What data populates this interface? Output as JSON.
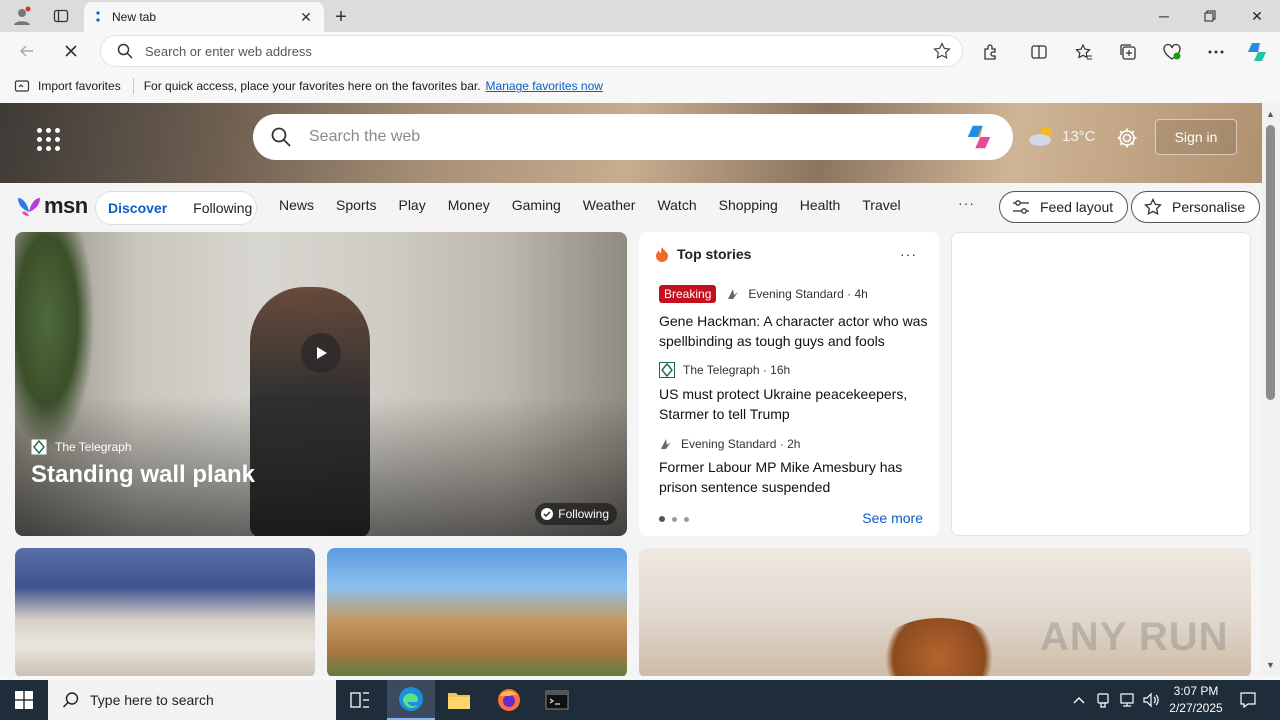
{
  "browser": {
    "tab_title": "New tab",
    "address_placeholder": "Search or enter web address"
  },
  "favorites_bar": {
    "import_label": "Import favorites",
    "hint": "For quick access, place your favorites here on the favorites bar.",
    "manage_link": "Manage favorites now"
  },
  "msn": {
    "search_placeholder": "Search the web",
    "temperature": "13°C",
    "sign_in": "Sign in",
    "logo_text": "msn",
    "feed_tabs": [
      "Discover",
      "Following"
    ],
    "categories": [
      "News",
      "Sports",
      "Play",
      "Money",
      "Gaming",
      "Weather",
      "Watch",
      "Shopping",
      "Health",
      "Travel"
    ],
    "more": "···",
    "feed_layout": "Feed layout",
    "personalise": "Personalise"
  },
  "hero": {
    "source": "The Telegraph",
    "title": "Standing wall plank",
    "following": "Following"
  },
  "top_stories": {
    "heading": "Top stories",
    "more": "···",
    "see_more": "See more",
    "stories": [
      {
        "badge": "Breaking",
        "source": "Evening Standard · 4h",
        "headline": "Gene Hackman: A character actor who was spellbinding as tough guys and fools"
      },
      {
        "badge": "",
        "source": "The Telegraph · 16h",
        "headline": "US must protect Ukraine peacekeepers, Starmer to tell Trump"
      },
      {
        "badge": "",
        "source": "Evening Standard · 2h",
        "headline": "Former Labour MP Mike Amesbury has prison sentence suspended"
      }
    ]
  },
  "watermark": "ANY RUN",
  "taskbar": {
    "search_placeholder": "Type here to search",
    "time": "3:07 PM",
    "date": "2/27/2025"
  },
  "colors": {
    "accent": "#0a5ec4",
    "breaking": "#c50f1f",
    "taskbar": "#1f2c3a"
  }
}
